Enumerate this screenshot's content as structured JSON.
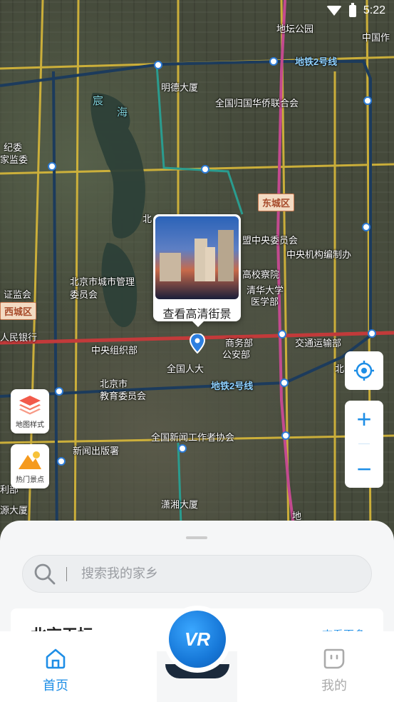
{
  "status_bar": {
    "time": "5:22",
    "wifi_icon": "wifi-icon",
    "battery_icon": "battery-charging-icon"
  },
  "map": {
    "labels": [
      {
        "text": "地坛公园"
      },
      {
        "text": "中国作"
      },
      {
        "text": "地铁2号线"
      },
      {
        "text": "明德大厦"
      },
      {
        "text": "全国归国华侨联合会"
      },
      {
        "text": "宸"
      },
      {
        "text": "海"
      },
      {
        "text": "东城区"
      },
      {
        "text": "北"
      },
      {
        "text": "盟中央委员会"
      },
      {
        "text": "中央机构编制办"
      },
      {
        "text": "北京市城市管理"
      },
      {
        "text": "委员会"
      },
      {
        "text": "高校察院"
      },
      {
        "text": "清华大学"
      },
      {
        "text": "医学部"
      },
      {
        "text": "证监会"
      },
      {
        "text": "西城区"
      },
      {
        "text": "人民银行"
      },
      {
        "text": "中央组织部"
      },
      {
        "text": "商务部"
      },
      {
        "text": "公安部"
      },
      {
        "text": "交通运输部"
      },
      {
        "text": "全国人大"
      },
      {
        "text": "北京市"
      },
      {
        "text": "教育委员会"
      },
      {
        "text": "地铁2号线"
      },
      {
        "text": "全国新闻工作者协会"
      },
      {
        "text": "新闻出版署"
      },
      {
        "text": "潇湘大厦"
      },
      {
        "text": "源大厦"
      },
      {
        "text": "纪委"
      },
      {
        "text": "家监委"
      },
      {
        "text": "利部"
      },
      {
        "text": "北"
      },
      {
        "text": "地"
      }
    ]
  },
  "popup": {
    "label": "查看高清街景"
  },
  "side_buttons": {
    "map_style": "地图样式",
    "hot_spots": "热门景点"
  },
  "controls": {
    "zoom_in": "+",
    "zoom_out": "−"
  },
  "sheet": {
    "search": {
      "placeholder": "搜索我的家乡",
      "value": ""
    },
    "card": {
      "title": "北京天坛",
      "more": "查看更多"
    }
  },
  "nav": {
    "home": "首页",
    "vr": "VR",
    "mine": "我的",
    "active_color": "#1e8ee6",
    "inactive_color": "#aaaaaa"
  }
}
